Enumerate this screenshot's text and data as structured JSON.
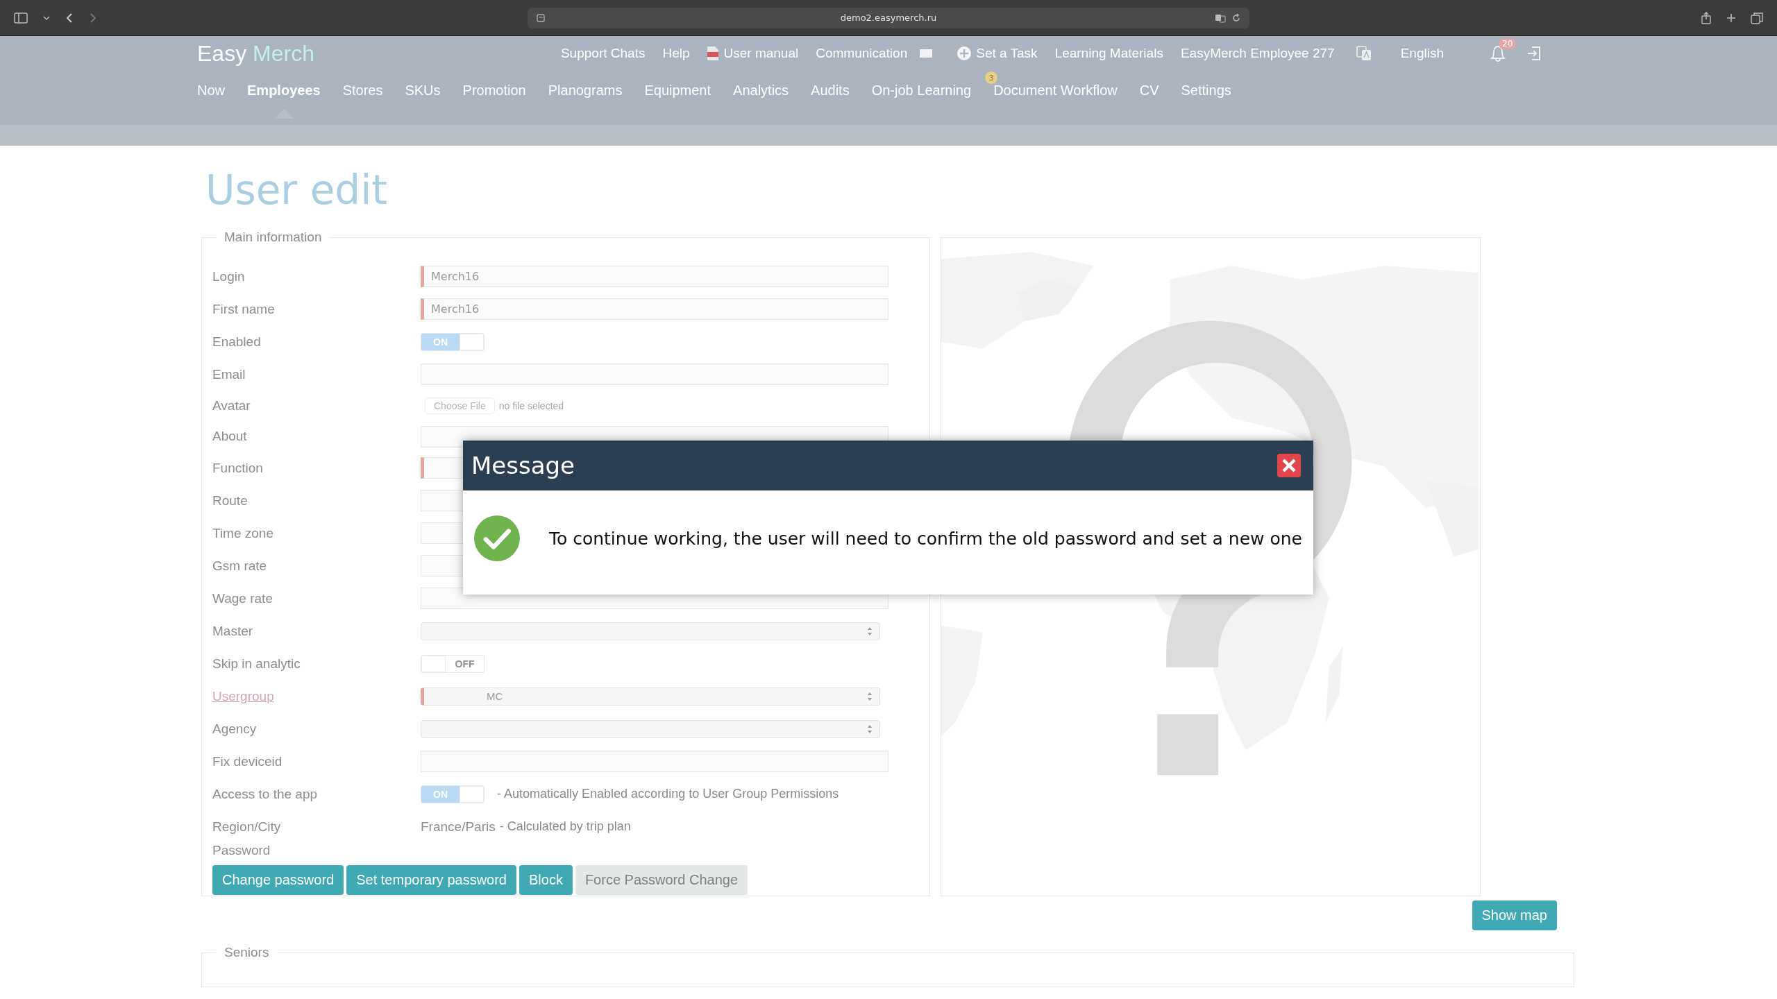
{
  "browser": {
    "url": "demo2.easymerch.ru"
  },
  "header": {
    "logo": {
      "first": "Easy",
      "second": "Merch"
    },
    "top_links": [
      {
        "label": "Support Chats",
        "kind": "text"
      },
      {
        "label": "Help",
        "kind": "text"
      },
      {
        "label": "User manual",
        "kind": "pdf"
      },
      {
        "label": "Communication",
        "kind": "mail"
      },
      {
        "label": "Set a Task",
        "kind": "add"
      },
      {
        "label": "Learning Materials",
        "kind": "text"
      },
      {
        "label": "EasyMerch Employee 277",
        "kind": "text"
      },
      {
        "label": "English",
        "kind": "language"
      }
    ],
    "notifications": {
      "count": "20"
    }
  },
  "nav": {
    "items": [
      {
        "label": "Now",
        "selected": false
      },
      {
        "label": "Employees",
        "selected": true
      },
      {
        "label": "Stores",
        "selected": false
      },
      {
        "label": "SKUs",
        "selected": false
      },
      {
        "label": "Promotion",
        "selected": false
      },
      {
        "label": "Planograms",
        "selected": false
      },
      {
        "label": "Equipment",
        "selected": false
      },
      {
        "label": "Analytics",
        "selected": false
      },
      {
        "label": "Audits",
        "selected": false
      },
      {
        "label": "On-job Learning",
        "selected": false
      },
      {
        "label": "Document Workflow",
        "selected": false,
        "badge": "3"
      },
      {
        "label": "CV",
        "selected": false
      },
      {
        "label": "Settings",
        "selected": false
      }
    ]
  },
  "page_title": "User edit",
  "main_information": {
    "legend": "Main information",
    "fields": [
      {
        "label": "Login",
        "kind": "text",
        "value": "Merch16",
        "required": true
      },
      {
        "label": "First name",
        "kind": "text",
        "value": "Merch16",
        "required": true
      },
      {
        "label": "Enabled",
        "kind": "toggle",
        "on": true,
        "toggle_label": "ON"
      },
      {
        "label": "Email",
        "kind": "text",
        "required": false
      },
      {
        "label": "Avatar",
        "kind": "file",
        "button": "Choose File",
        "status": "no file selected"
      },
      {
        "label": "About",
        "kind": "text",
        "required": false
      },
      {
        "label": "Function",
        "kind": "text",
        "required": true
      },
      {
        "label": "Route",
        "kind": "text",
        "required": false
      },
      {
        "label": "Time zone",
        "kind": "text",
        "required": false
      },
      {
        "label": "Gsm rate",
        "kind": "text",
        "required": false
      },
      {
        "label": "Wage rate",
        "kind": "text",
        "required": false
      },
      {
        "label": "Master",
        "kind": "select",
        "required": false
      },
      {
        "label": "Skip in analytic",
        "kind": "toggle",
        "on": false,
        "toggle_label": "OFF"
      },
      {
        "label": "Usergroup",
        "kind": "select",
        "value": "MC",
        "required": true,
        "link": true
      },
      {
        "label": "Agency",
        "kind": "select",
        "required": false
      },
      {
        "label": "Fix deviceid",
        "kind": "text",
        "required": false
      },
      {
        "label": "Access to the app",
        "kind": "toggle",
        "on": true,
        "toggle_label": "ON",
        "note": "- Automatically Enabled according to User Group Permissions"
      },
      {
        "label": "Region/City",
        "kind": "static",
        "value": "France/Paris",
        "note": "- Calculated by trip plan"
      },
      {
        "label": "Password",
        "kind": "heading"
      }
    ],
    "buttons": [
      {
        "label": "Change password",
        "disabled": false
      },
      {
        "label": "Set temporary password",
        "disabled": false
      },
      {
        "label": "Block",
        "disabled": false
      },
      {
        "label": "Force Password Change",
        "disabled": true
      }
    ]
  },
  "map": {
    "kind": "picture",
    "button": "Show map"
  },
  "seniors": {
    "legend": "Seniors"
  },
  "modal": {
    "title": "Message",
    "message": "To continue working, the user will need to confirm the old password and set a new one",
    "kind": "success"
  }
}
